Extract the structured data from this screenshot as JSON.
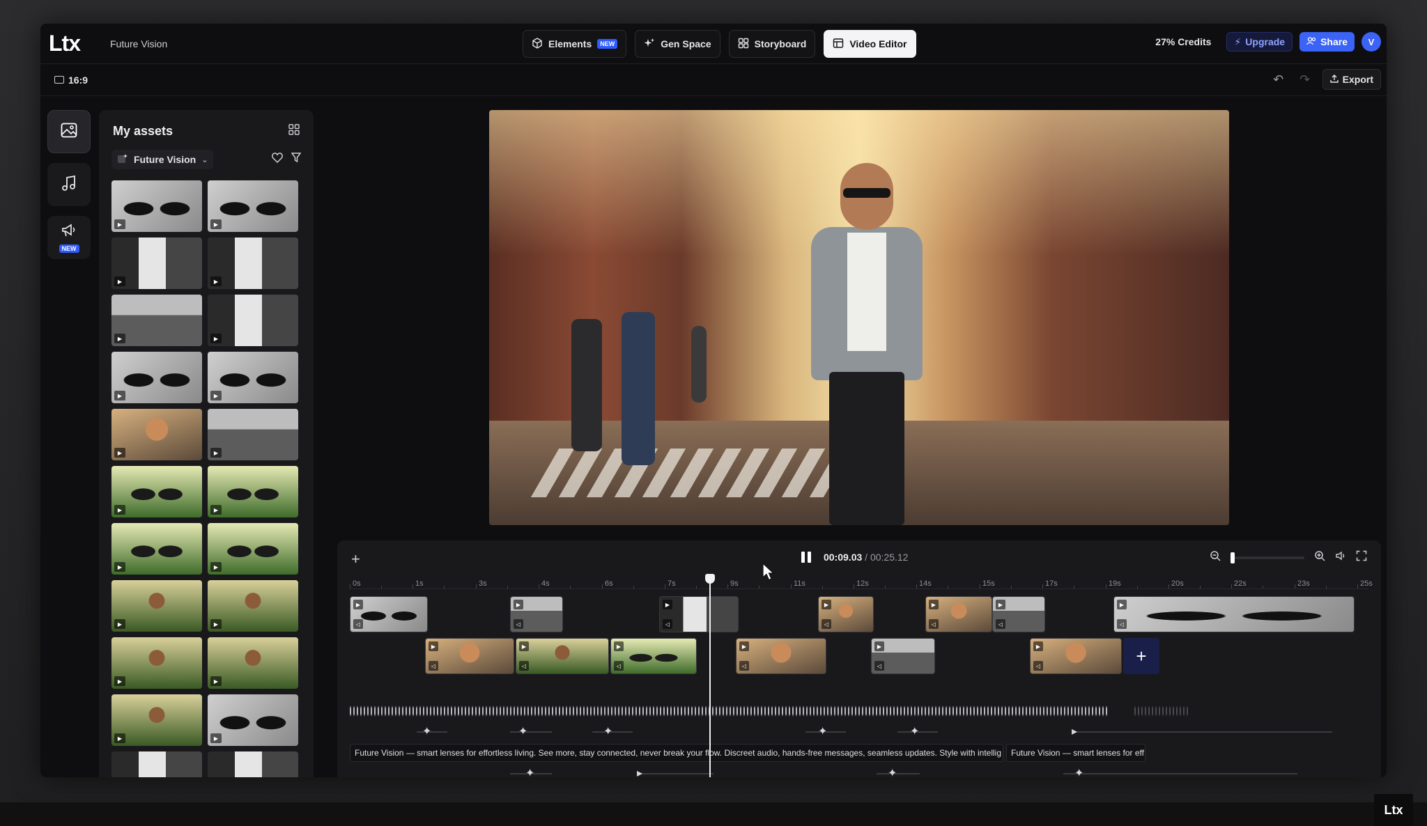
{
  "app": {
    "logo": "Ltx",
    "project_title": "Future Vision",
    "corner_logo": "Ltx"
  },
  "nav": {
    "tabs": [
      {
        "label": "Elements",
        "badge": "NEW",
        "icon": "cube-icon"
      },
      {
        "label": "Gen Space",
        "icon": "sparkles-icon"
      },
      {
        "label": "Storyboard",
        "icon": "grid-icon"
      },
      {
        "label": "Video Editor",
        "icon": "editor-icon",
        "active": true
      }
    ],
    "credits": "27% Credits",
    "upgrade_label": "Upgrade",
    "share_label": "Share",
    "avatar_initial": "V"
  },
  "subbar": {
    "aspect_ratio": "16:9",
    "export_label": "Export"
  },
  "rail": {
    "items": [
      {
        "icon": "image-icon",
        "active": true
      },
      {
        "icon": "music-icon"
      },
      {
        "icon": "megaphone-icon",
        "badge": "NEW"
      }
    ]
  },
  "assets": {
    "title": "My assets",
    "folder": "Future Vision",
    "thumbnails": [
      "t-glasses",
      "t-glasses",
      "t-building",
      "t-building",
      "t-street",
      "t-building",
      "t-glasses",
      "t-glasses",
      "t-face",
      "t-street",
      "t-park",
      "t-park",
      "t-park",
      "t-park",
      "t-runner",
      "t-runner",
      "t-runner",
      "t-runner",
      "t-runner",
      "t-glasses",
      "t-building",
      "t-building"
    ]
  },
  "timeline": {
    "current_time": "00:09.03",
    "separator": " / ",
    "total_time": "00:25.12",
    "ruler_labels": [
      "0s",
      "1s",
      "3s",
      "4s",
      "6s",
      "7s",
      "9s",
      "11s",
      "12s",
      "14s",
      "15s",
      "17s",
      "19s",
      "20s",
      "22s",
      "23s",
      "25s"
    ],
    "captions": [
      "Future Vision — smart lenses for effortless living. See more, stay connected, never break your flow. Discreet audio, hands-free messages, seamless updates. Style with intellig",
      "Future Vision — smart lenses for eff"
    ],
    "accent": "#2f5bff"
  }
}
